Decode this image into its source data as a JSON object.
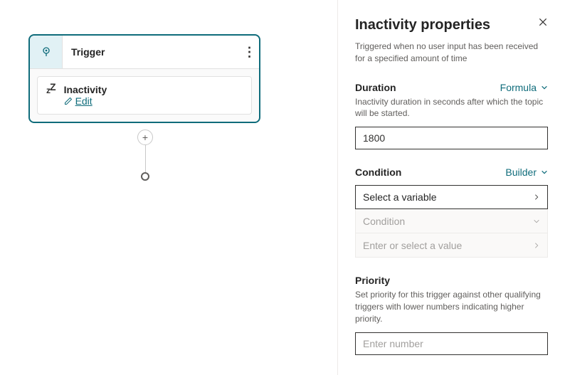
{
  "canvas": {
    "triggerTitle": "Trigger",
    "inactivityTitle": "Inactivity",
    "editLabel": "Edit"
  },
  "panel": {
    "title": "Inactivity properties",
    "subtitle": "Triggered when no user input has been received for a specified amount of time",
    "duration": {
      "title": "Duration",
      "linkLabel": "Formula",
      "desc": "Inactivity duration in seconds after which the topic will be started.",
      "value": "1800"
    },
    "condition": {
      "title": "Condition",
      "linkLabel": "Builder",
      "selectPlaceholder": "Select a variable",
      "conditionLabel": "Condition",
      "valuePlaceholder": "Enter or select a value"
    },
    "priority": {
      "title": "Priority",
      "desc": "Set priority for this trigger against other qualifying triggers with lower numbers indicating higher priority.",
      "placeholder": "Enter number"
    }
  }
}
